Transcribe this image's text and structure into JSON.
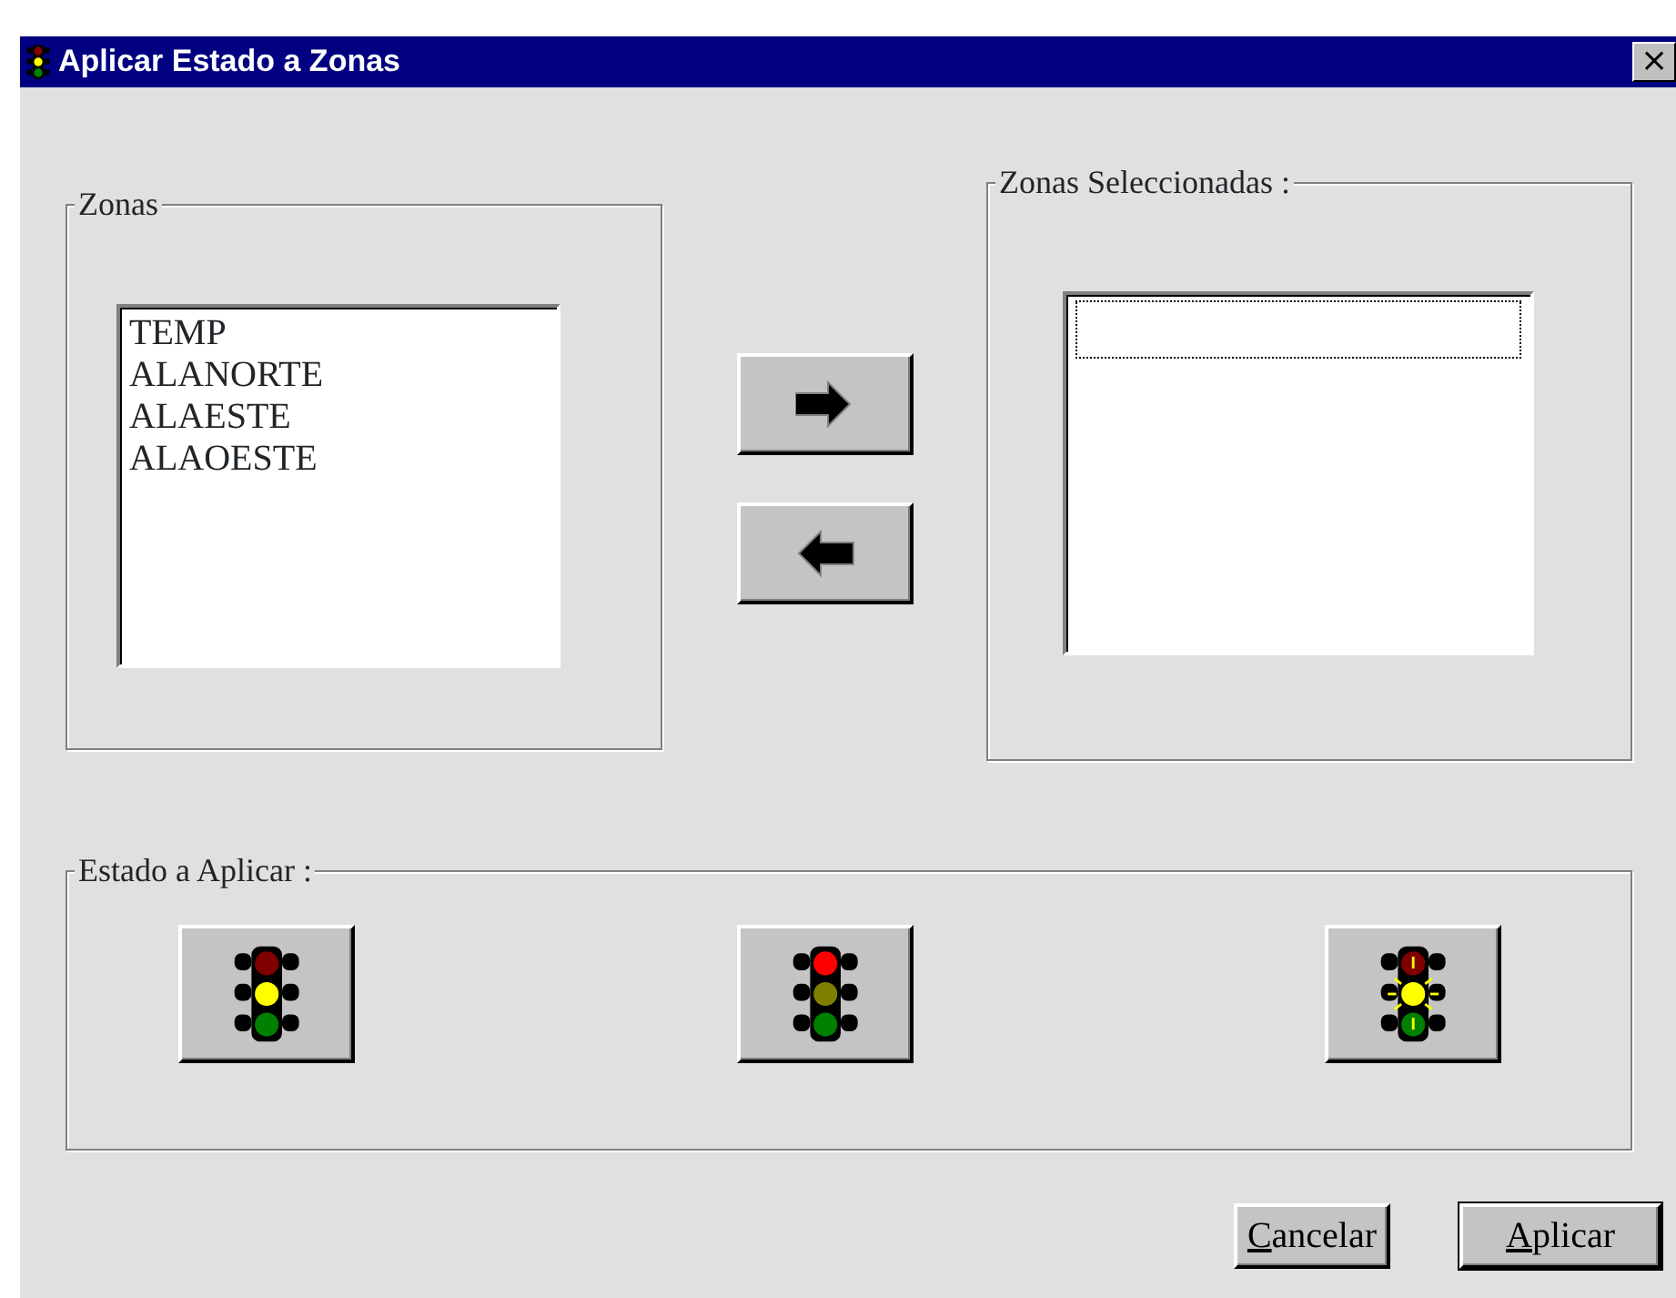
{
  "window": {
    "title": "Aplicar Estado a Zonas",
    "close": "×"
  },
  "zonas": {
    "legend": "Zonas",
    "items": [
      {
        "label": "TEMP",
        "selected": false
      },
      {
        "label": "ALANORTE",
        "selected": false
      },
      {
        "label": "ALAESTE",
        "selected": false
      },
      {
        "label": "ALAOESTE",
        "selected": false
      }
    ]
  },
  "move_buttons": [
    {
      "kind": "right"
    },
    {
      "kind": "left"
    }
  ],
  "seleccionadas": {
    "legend": "Zonas Seleccionadas :",
    "focused_empty_row": true
  },
  "estado": {
    "legend": "Estado a Aplicar :",
    "buttons": [
      {
        "kind": "yellow"
      },
      {
        "kind": "red"
      },
      {
        "kind": "flashing"
      }
    ]
  },
  "buttons": [
    {
      "label": "Cancelar",
      "underline_first": true,
      "default": false
    },
    {
      "label": "Aplicar",
      "underline_first": true,
      "default": true
    }
  ]
}
